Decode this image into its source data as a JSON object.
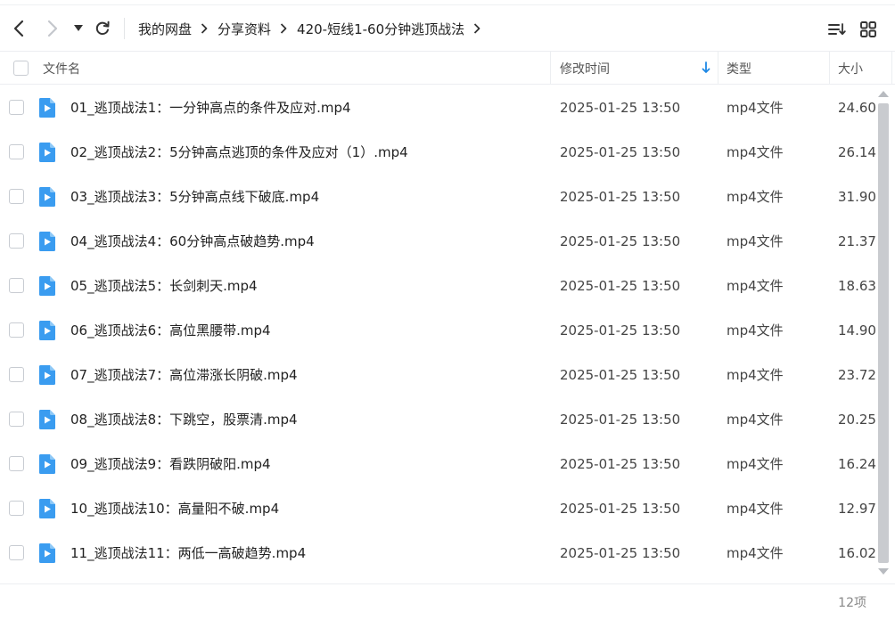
{
  "toolbar": {
    "back_icon": "chevron-left-icon",
    "forward_icon": "chevron-right-icon",
    "history_icon": "caret-down-icon",
    "refresh_icon": "refresh-icon",
    "sort_icon": "sort-list-icon",
    "view_icon": "grid-view-icon"
  },
  "breadcrumb": [
    "我的网盘",
    "分享资料",
    "420-短线1-60分钟逃顶战法"
  ],
  "columns": {
    "name": "文件名",
    "modified": "修改时间",
    "type": "类型",
    "size": "大小",
    "sorted_by": "modified",
    "sort_direction": "descending"
  },
  "files": [
    {
      "name": "01_逃顶战法1：一分钟高点的条件及应对.mp4",
      "modified": "2025-01-25 13:50",
      "type": "mp4文件",
      "size": "24.60"
    },
    {
      "name": "02_逃顶战法2：5分钟高点逃顶的条件及应对（1）.mp4",
      "modified": "2025-01-25 13:50",
      "type": "mp4文件",
      "size": "26.14"
    },
    {
      "name": "03_逃顶战法3：5分钟高点线下破底.mp4",
      "modified": "2025-01-25 13:50",
      "type": "mp4文件",
      "size": "31.90"
    },
    {
      "name": "04_逃顶战法4：60分钟高点破趋势.mp4",
      "modified": "2025-01-25 13:50",
      "type": "mp4文件",
      "size": "21.37"
    },
    {
      "name": "05_逃顶战法5：长剑刺天.mp4",
      "modified": "2025-01-25 13:50",
      "type": "mp4文件",
      "size": "18.63"
    },
    {
      "name": "06_逃顶战法6：高位黑腰带.mp4",
      "modified": "2025-01-25 13:50",
      "type": "mp4文件",
      "size": "14.90"
    },
    {
      "name": "07_逃顶战法7：高位滞涨长阴破.mp4",
      "modified": "2025-01-25 13:50",
      "type": "mp4文件",
      "size": "23.72"
    },
    {
      "name": "08_逃顶战法8：下跳空，股票清.mp4",
      "modified": "2025-01-25 13:50",
      "type": "mp4文件",
      "size": "20.25"
    },
    {
      "name": "09_逃顶战法9：看跌阴破阳.mp4",
      "modified": "2025-01-25 13:50",
      "type": "mp4文件",
      "size": "16.24"
    },
    {
      "name": "10_逃顶战法10：高量阳不破.mp4",
      "modified": "2025-01-25 13:50",
      "type": "mp4文件",
      "size": "12.97"
    },
    {
      "name": "11_逃顶战法11：两低一高破趋势.mp4",
      "modified": "2025-01-25 13:50",
      "type": "mp4文件",
      "size": "16.02"
    }
  ],
  "footer": {
    "item_count": "12项"
  },
  "colors": {
    "accent": "#1e88e5",
    "video_icon": "#3a9cf0",
    "divider": "#eceef1"
  }
}
